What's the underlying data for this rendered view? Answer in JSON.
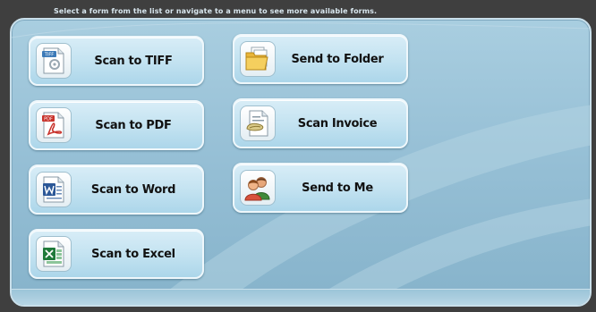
{
  "header": {
    "instruction": "Select a form from the list or navigate to a menu to see more available forms."
  },
  "tiles": [
    {
      "label": "Scan to TIFF",
      "icon": "tiff-file-icon"
    },
    {
      "label": "Scan to PDF",
      "icon": "pdf-file-icon"
    },
    {
      "label": "Scan to Word",
      "icon": "word-document-icon"
    },
    {
      "label": "Scan to Excel",
      "icon": "excel-spreadsheet-icon"
    },
    {
      "label": "Send to Folder",
      "icon": "folder-icon"
    },
    {
      "label": "Scan Invoice",
      "icon": "invoice-icon"
    },
    {
      "label": "Send to Me",
      "icon": "users-icon"
    }
  ],
  "tiff_badge": "TIFF",
  "pdf_badge": "PDF",
  "colors": {
    "panel_top": "#a9cee0",
    "panel_bottom": "#86b3cb",
    "tile_light": "#d8edf7",
    "tile_dark": "#acd6ea",
    "pdf_red": "#c8322b",
    "word_blue": "#2b5797",
    "excel_green": "#1f7a3a"
  }
}
